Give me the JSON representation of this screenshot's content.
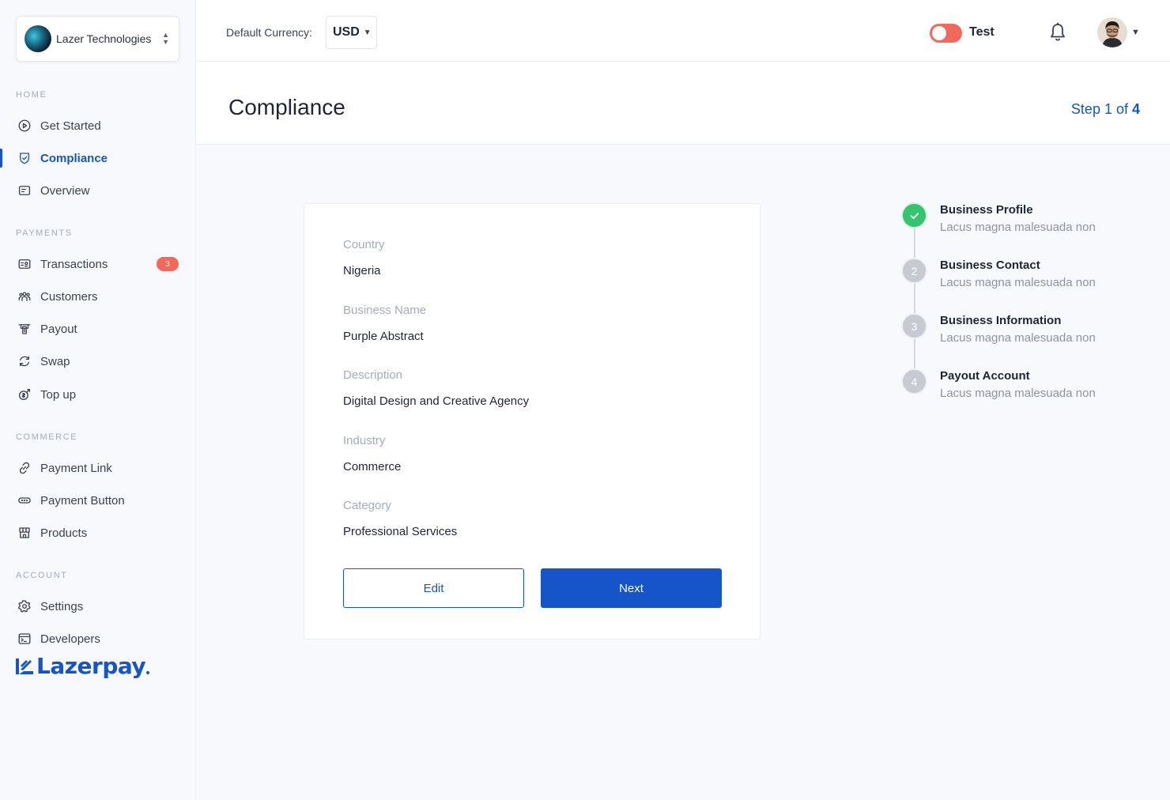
{
  "org": {
    "name": "Lazer Technologies"
  },
  "header": {
    "currency_label": "Default Currency:",
    "currency_value": "USD",
    "mode_label": "Test"
  },
  "sidebar": {
    "sections": {
      "home": "HOME",
      "payments": "PAYMENTS",
      "commerce": "COMMERCE",
      "account": "ACCOUNT"
    },
    "items": {
      "get_started": "Get Started",
      "compliance": "Compliance",
      "overview": "Overview",
      "transactions": "Transactions",
      "transactions_badge": "3",
      "customers": "Customers",
      "payout": "Payout",
      "swap": "Swap",
      "top_up": "Top up",
      "payment_link": "Payment Link",
      "payment_button": "Payment Button",
      "products": "Products",
      "settings": "Settings",
      "developers": "Developers"
    },
    "brand": "Lazerpay"
  },
  "page": {
    "title": "Compliance",
    "step_prefix": "Step 1 of ",
    "step_total": "4"
  },
  "form": {
    "country_label": "Country",
    "country_value": "Nigeria",
    "business_name_label": "Business Name",
    "business_name_value": "Purple Abstract",
    "description_label": "Description",
    "description_value": "Digital Design and Creative Agency",
    "industry_label": "Industry",
    "industry_value": "Commerce",
    "category_label": "Category",
    "category_value": "Professional Services",
    "edit_label": "Edit",
    "next_label": "Next"
  },
  "steps": [
    {
      "number": "1",
      "title": "Business Profile",
      "subtitle": "Lacus magna malesuada non",
      "status": "done"
    },
    {
      "number": "2",
      "title": "Business Contact",
      "subtitle": "Lacus magna malesuada non",
      "status": "pending"
    },
    {
      "number": "3",
      "title": "Business Information",
      "subtitle": "Lacus magna malesuada non",
      "status": "pending"
    },
    {
      "number": "4",
      "title": "Payout Account",
      "subtitle": "Lacus magna malesuada non",
      "status": "pending"
    }
  ],
  "colors": {
    "accent": "#1554c9",
    "success": "#35c46d",
    "badge": "#f0695a",
    "toggle": "#f0695a"
  }
}
